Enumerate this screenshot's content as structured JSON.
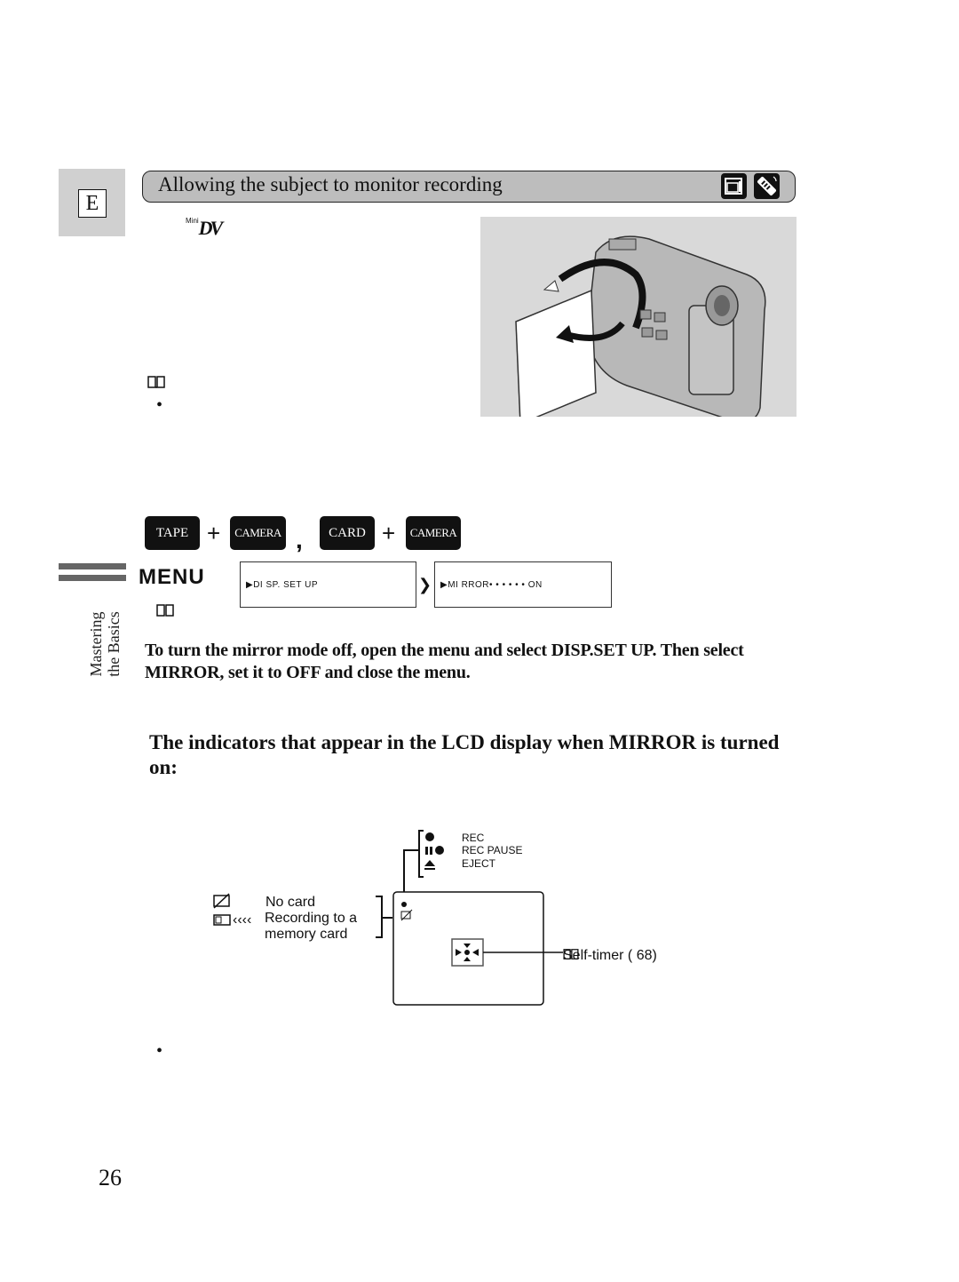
{
  "page": {
    "language_tab": "E",
    "section_title": "Allowing the subject to monitor recording",
    "header_icons": [
      "camcorder-icon",
      "remote-control-icon"
    ],
    "format_logo": {
      "prefix": "Mini",
      "main": "DV"
    },
    "page_number": "26",
    "side_label": [
      "Mastering",
      "the Basics"
    ]
  },
  "modes": {
    "items": [
      {
        "label": "TAPE"
      },
      {
        "label": "CAMERA"
      },
      {
        "label": "CARD"
      },
      {
        "label": "CAMERA"
      }
    ],
    "plus": "+",
    "separator": ","
  },
  "menu": {
    "label": "MENU",
    "screen1": "▶DI SP. SET  UP",
    "screen2": "▶MI RROR• • • • • • ON",
    "arrow": "❯"
  },
  "instructions": "To turn the mirror mode off, open the menu and select DISP.SET UP. Then select MIRROR, set it to OFF and close the menu.",
  "subheading": "The indicators that appear in the LCD display when MIRROR is turned on:",
  "lcd_diagram": {
    "tape_indicators": [
      {
        "icon": "rec-icon",
        "label": "REC"
      },
      {
        "icon": "rec-pause-icon",
        "label": "REC PAUSE"
      },
      {
        "icon": "eject-icon",
        "label": "EJECT"
      }
    ],
    "card_indicators": [
      {
        "icon": "no-card-icon",
        "label": "No card"
      },
      {
        "icon": "recording-to-card-icon",
        "label_line1": "Recording to a",
        "label_line2": "memory card"
      }
    ],
    "self_timer_label": "Self-timer (",
    "self_timer_ref": "68)"
  },
  "bullets": [
    "•",
    "•"
  ]
}
